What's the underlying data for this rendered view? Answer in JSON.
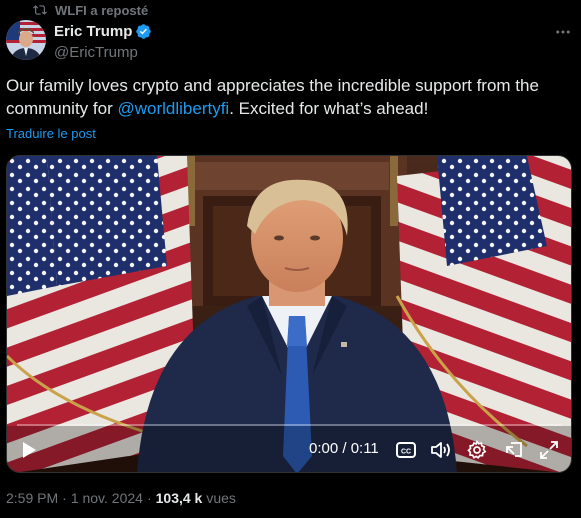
{
  "repost": {
    "label": "WLFI a reposté"
  },
  "author": {
    "name": "Eric Trump",
    "handle": "@EricTrump"
  },
  "tweet": {
    "text_before": "Our family loves crypto and appreciates the incredible support from the community for ",
    "mention": "@worldlibertyfi",
    "text_after": ". Excited for what’s ahead!",
    "translate_label": "Traduire le post"
  },
  "video": {
    "time": "0:00 / 0:11",
    "progress": 0
  },
  "meta": {
    "time": "2:59 PM",
    "separator": "·",
    "date": "1 nov. 2024",
    "separator2": "·",
    "views": "103,4 k",
    "views_label": "vues"
  },
  "colors": {
    "accent": "#1d9bf0",
    "muted": "#71767b",
    "text": "#e7e9ea",
    "background": "#000000"
  },
  "icons": [
    "repost-icon",
    "verified-badge-icon",
    "more-icon",
    "play-icon",
    "captions-icon",
    "volume-icon",
    "settings-icon",
    "pip-icon",
    "fullscreen-icon"
  ]
}
